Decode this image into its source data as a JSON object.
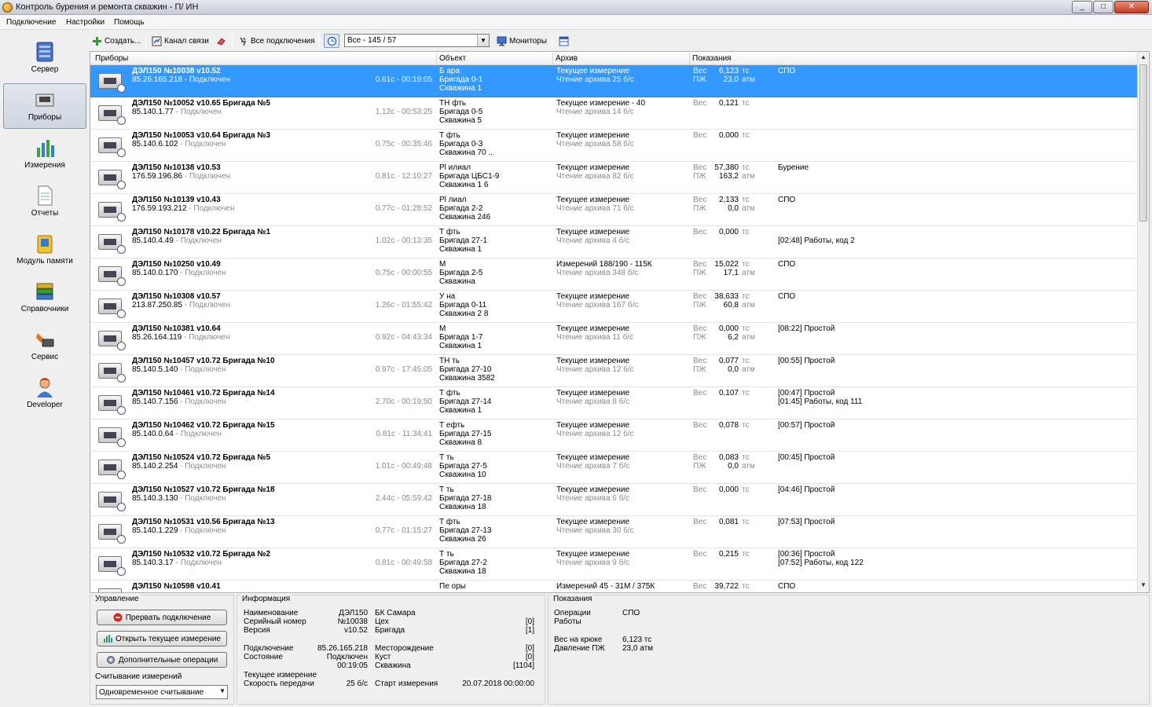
{
  "window": {
    "title": "Контроль бурения и ремонта скважин - П/        ИН",
    "controls": [
      "_",
      "□",
      "✕"
    ]
  },
  "menu": [
    "Подключение",
    "Настройки",
    "Помощь"
  ],
  "toolbar": {
    "create": "Создать...",
    "channel": "Канал связи",
    "all_connections": "Все подключения",
    "filter_value": "Все - 145 / 57",
    "monitors": "Мониторы"
  },
  "sidebar": [
    {
      "label": "Сервер",
      "icon": "server-icon"
    },
    {
      "label": "Приборы",
      "icon": "devices-icon",
      "active": true
    },
    {
      "label": "Измерения",
      "icon": "chart-icon"
    },
    {
      "label": "Отчеты",
      "icon": "report-icon"
    },
    {
      "label": "Модуль памяти",
      "icon": "memory-module-icon"
    },
    {
      "label": "Справочники",
      "icon": "books-icon"
    },
    {
      "label": "Сервис",
      "icon": "service-icon"
    },
    {
      "label": "Developer",
      "icon": "developer-icon"
    }
  ],
  "columns": [
    "Приборы",
    "Объект",
    "Архив",
    "Показания"
  ],
  "devices": [
    {
      "name": "ДЭЛ150  №10038 v10.52",
      "ip": "85.26.165.218",
      "status": " - Подключен",
      "time": "0.61c - 00:19:05",
      "obj": [
        "Б      ара",
        "Бригада 0-1",
        "Скважина 1"
      ],
      "arch1": "Текущее измерение",
      "arch2": "Чтение архива 25 б/с",
      "l1": "Вес",
      "v1": "6,123",
      "u1": "тс",
      "l2": "ПЖ",
      "v2": "23,0",
      "u2": "атм",
      "note1": "СПО",
      "note2": ""
    },
    {
      "name": "ДЭЛ150  №10052 v10.65  Бригада №5",
      "ip": "85.140.1.77",
      "status": " - Подключен",
      "time": "1.12c - 00:53:25",
      "obj": [
        "ТН         фть",
        "Бригада 0-5",
        "Скважина 5"
      ],
      "arch1": "Текущее измерение - 40",
      "arch2": "Чтение архива 14 б/с",
      "l1": "Вес",
      "v1": "0,121",
      "u1": "тс",
      "l2": "",
      "v2": "",
      "u2": "",
      "note1": "",
      "note2": ""
    },
    {
      "name": "ДЭЛ150  №10053 v10.64  Бригада №3",
      "ip": "85.140.6.102",
      "status": " - Подключен",
      "time": "0.75c - 00:35:46",
      "obj": [
        "Т          фть",
        "Бригада 0-3",
        "Скважина 70      .."
      ],
      "arch1": "Текущее измерение",
      "arch2": "Чтение архива 58 б/с",
      "l1": "Вес",
      "v1": "0,000",
      "u1": "тс",
      "l2": "",
      "v2": "",
      "u2": "",
      "note1": "",
      "note2": ""
    },
    {
      "name": "ДЭЛ150  №10138 v10.53",
      "ip": "176.59.196.86",
      "status": " - Подключен",
      "time": "0.81c - 12:10:27",
      "obj": [
        "Рl                          илиал",
        "Бригада ЦБС1-9",
        "Скважина 1    6"
      ],
      "arch1": "Текущее измерение",
      "arch2": "Чтение архива 82 б/с",
      "l1": "Вес",
      "v1": "57,380",
      "u1": "тс",
      "l2": "ПЖ",
      "v2": "163,2",
      "u2": "атм",
      "note1": "Бурение",
      "note2": ""
    },
    {
      "name": "ДЭЛ150  №10139 v10.43",
      "ip": "176.59.193.212",
      "status": " - Подключен",
      "time": "0.77c - 01:28:52",
      "obj": [
        "Рl                          лиал",
        "Бригада 2-2",
        "Скважина 246"
      ],
      "arch1": "Текущее измерение",
      "arch2": "Чтение архива 71 б/с",
      "l1": "Вес",
      "v1": "2,133",
      "u1": "тс",
      "l2": "ПЖ",
      "v2": "0,0",
      "u2": "атм",
      "note1": "СПО",
      "note2": ""
    },
    {
      "name": "ДЭЛ150  №10178 v10.22  Бригада №1",
      "ip": "85.140.4.49",
      "status": " - Подключен",
      "time": "1.02c - 00:13:35",
      "obj": [
        "Т           фть",
        "Бригада 27-1",
        "Скважина 1"
      ],
      "arch1": "Текущее измерение",
      "arch2": "Чтение архива 4 б/с",
      "l1": "Вес",
      "v1": "0,000",
      "u1": "тс",
      "l2": "",
      "v2": "",
      "u2": "",
      "note1": "",
      "note2": "[02:48] Работы, код 2"
    },
    {
      "name": "ДЭЛ150  №10250 v10.49",
      "ip": "85.140.0.170",
      "status": " - Подключен",
      "time": "0.75c - 00:00:55",
      "obj": [
        "М",
        "Бригада 2-5",
        "Скважина"
      ],
      "arch1": "Измерений 188/190 - 115К",
      "arch2": "Чтение архива 348 б/с",
      "l1": "Вес",
      "v1": "15,022",
      "u1": "тс",
      "l2": "ПЖ",
      "v2": "17,1",
      "u2": "атм",
      "note1": "СПО",
      "note2": ""
    },
    {
      "name": "ДЭЛ150  №10308 v10.57",
      "ip": "213.87.250.85",
      "status": " - Подключен",
      "time": "1.26c - 01:55:42",
      "obj": [
        "У                   на",
        "Бригада 0-11",
        "Скважина 2     8"
      ],
      "arch1": "Текущее измерение",
      "arch2": "Чтение архива 167 б/с",
      "l1": "Вес",
      "v1": "38,633",
      "u1": "тс",
      "l2": "ПЖ",
      "v2": "60,8",
      "u2": "атм",
      "note1": "СПО",
      "note2": ""
    },
    {
      "name": "ДЭЛ150  №10381 v10.64",
      "ip": "85.26.164.119",
      "status": " - Подключен",
      "time": "0.92c - 04:43:34",
      "obj": [
        "М",
        "Бригада 1-7",
        "Скважина 1"
      ],
      "arch1": "Текущее измерение",
      "arch2": "Чтение архива 11 б/с",
      "l1": "Вес",
      "v1": "0,000",
      "u1": "тс",
      "l2": "ПЖ",
      "v2": "6,2",
      "u2": "атм",
      "note1": "[08:22] Простой",
      "note2": ""
    },
    {
      "name": "ДЭЛ150  №10457 v10.72  Бригада №10",
      "ip": "85.140.5.140",
      "status": " - Подключен",
      "time": "0.97c - 17:45:05",
      "obj": [
        "ТН            ть",
        "Бригада 27-10",
        "Скважина 3582"
      ],
      "arch1": "Текущее измерение",
      "arch2": "Чтение архива 12 б/с",
      "l1": "Вес",
      "v1": "0,077",
      "u1": "тс",
      "l2": "ПЖ",
      "v2": "0,0",
      "u2": "атм",
      "note1": "[00:55] Простой",
      "note2": ""
    },
    {
      "name": "ДЭЛ150  №10461 v10.72  Бригада №14",
      "ip": "85.140.7.156",
      "status": " - Подключен",
      "time": "2.70c - 00:19:50",
      "obj": [
        "Т            фть",
        "Бригада 27-14",
        "Скважина 1"
      ],
      "arch1": "Текущее измерение",
      "arch2": "Чтение архива 8 б/с",
      "l1": "Вес",
      "v1": "0,107",
      "u1": "тс",
      "l2": "",
      "v2": "",
      "u2": "",
      "note1": "[00:47] Простой",
      "note2": "[01:45] Работы, код 111"
    },
    {
      "name": "ДЭЛ150  №10462 v10.72  Бригада №15",
      "ip": "85.140.0.64",
      "status": " - Подключен",
      "time": "0.81c - 11:34:41",
      "obj": [
        "Т             ефть",
        "Бригада 27-15",
        "Скважина 8"
      ],
      "arch1": "Текущее измерение",
      "arch2": "Чтение архива 12 б/с",
      "l1": "Вес",
      "v1": "0,078",
      "u1": "тс",
      "l2": "",
      "v2": "",
      "u2": "",
      "note1": "[00:57] Простой",
      "note2": ""
    },
    {
      "name": "ДЭЛ150  №10524 v10.72  Бригада №5",
      "ip": "85.140.2.254",
      "status": " - Подключен",
      "time": "1.01c - 00:49:48",
      "obj": [
        "Т            ть",
        "Бригада 27-5",
        "Скважина 10"
      ],
      "arch1": "Текущее измерение",
      "arch2": "Чтение архива 7 б/с",
      "l1": "Вес",
      "v1": "0,083",
      "u1": "тс",
      "l2": "ПЖ",
      "v2": "0,0",
      "u2": "атм",
      "note1": "[00:45] Простой",
      "note2": ""
    },
    {
      "name": "ДЭЛ150  №10527 v10.72  Бригада №18",
      "ip": "85.140.3.130",
      "status": " - Подключен",
      "time": "2.44c - 05:59:42",
      "obj": [
        "Т            ть",
        "Бригада 27-18",
        "Скважина 18"
      ],
      "arch1": "Текущее измерение",
      "arch2": "Чтение архива 6 б/с",
      "l1": "Вес",
      "v1": "0,000",
      "u1": "тс",
      "l2": "",
      "v2": "",
      "u2": "",
      "note1": "[04:46] Простой",
      "note2": ""
    },
    {
      "name": "ДЭЛ150  №10531 v10.56  Бригада №13",
      "ip": "85.140.1.229",
      "status": " - Подключен",
      "time": "0.77c - 01:15:27",
      "obj": [
        "Т            фть",
        "Бригада 27-13",
        "Скважина 26"
      ],
      "arch1": "Текущее измерение",
      "arch2": "Чтение архива 30 б/с",
      "l1": "Вес",
      "v1": "0,081",
      "u1": "тс",
      "l2": "",
      "v2": "",
      "u2": "",
      "note1": "[07:53] Простой",
      "note2": ""
    },
    {
      "name": "ДЭЛ150  №10532 v10.72  Бригада №2",
      "ip": "85.140.3.17",
      "status": " - Подключен",
      "time": "0.81c - 00:49:58",
      "obj": [
        "Т            ть",
        "Бригада 27-2",
        "Скважина 18"
      ],
      "arch1": "Текущее измерение",
      "arch2": "Чтение архива 9 б/с",
      "l1": "Вес",
      "v1": "0,215",
      "u1": "тс",
      "l2": "",
      "v2": "",
      "u2": "",
      "note1": "[00:36] Простой",
      "note2": "[07:52] Работы, код 122"
    },
    {
      "name": "ДЭЛ150  №10598 v10.41",
      "ip": "",
      "status": "",
      "time": "",
      "obj": [
        "Пе                        оры",
        "",
        ""
      ],
      "arch1": "Измерений 45 - 31М / 375К",
      "arch2": "",
      "l1": "Вес",
      "v1": "39,722",
      "u1": "тс",
      "l2": "",
      "v2": "",
      "u2": "",
      "note1": "СПО",
      "note2": ""
    }
  ],
  "control": {
    "title": "Управление",
    "btn_stop": "Прервать подключение",
    "btn_open": "Открыть текущее измерение",
    "btn_more": "Дополнительные операции",
    "read_label": "Считывание измерений",
    "read_value": "Одновременное считывание"
  },
  "info": {
    "title": "Информация",
    "name_l": "Наименование",
    "name_v": "ДЭЛ150",
    "serial_l": "Серийный номер",
    "serial_v": "№10038",
    "version_l": "Версия",
    "version_v": "v10.52",
    "org": "БК Самара",
    "shop_l": "Цех",
    "shop_v": "[0]",
    "brig_l": "Бригада",
    "brig_v": "[1]",
    "conn_l": "Подключение",
    "conn_v": "85.26.165.218",
    "state_l": "Состояние",
    "state_v": "Подключен",
    "dur_v": "00:19:05",
    "field_l": "Месторождение",
    "field_v": "[0]",
    "bush_l": "Куст",
    "bush_v": "[0]",
    "well_l": "Скважина",
    "well_v": "[1104]",
    "cur_l": "Текущее измерение",
    "speed_l": "Скорость передачи",
    "speed_v": "25 б/с",
    "start_l": "Старт измерения",
    "start_v": "20.07.2018 00:00:00"
  },
  "readings": {
    "title": "Показания",
    "ops_l": "Операции",
    "ops_v": "СПО",
    "work_l": "Работы",
    "hook_l": "Вес на крюке",
    "hook_v": "6,123 тс",
    "press_l": "Давление ПЖ",
    "press_v": "23,0 атм"
  }
}
